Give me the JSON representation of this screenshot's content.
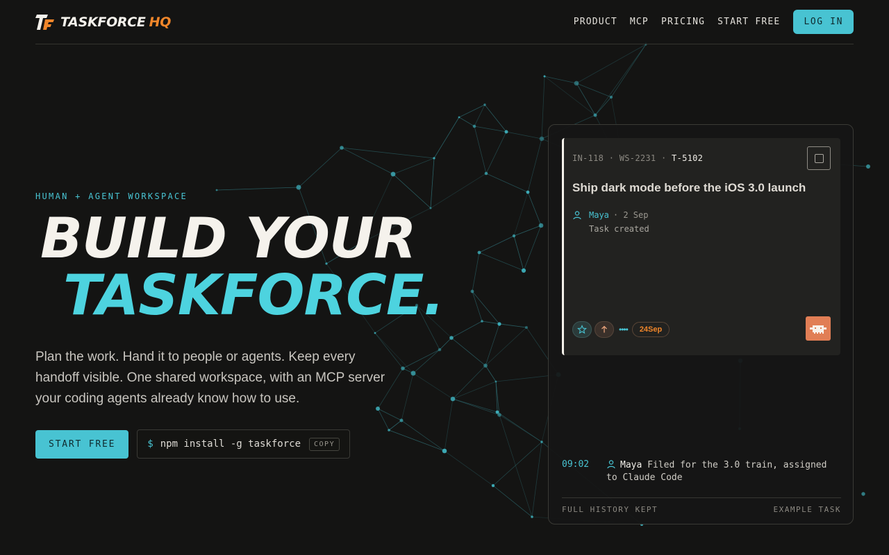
{
  "brand": {
    "name": "TASKFORCE",
    "suffix": "HQ"
  },
  "nav": {
    "items": [
      {
        "label": "PRODUCT"
      },
      {
        "label": "MCP"
      },
      {
        "label": "PRICING"
      },
      {
        "label": "START FREE"
      }
    ],
    "login_label": "LOG IN"
  },
  "hero": {
    "eyebrow": "HUMAN + AGENT WORKSPACE",
    "headline_line1": "BUILD YOUR",
    "headline_line2": "TASKFORCE.",
    "subhead": "Plan the work. Hand it to people or agents. Keep every handoff visible. One shared workspace, with an MCP server your coding agents already know how to use.",
    "cta_label": "START FREE",
    "install_prompt": "$",
    "install_command": "npm install -g taskforce",
    "copy_label": "COPY"
  },
  "task_card": {
    "ids": [
      "IN-118",
      "WS-2231"
    ],
    "current_id": "T-5102",
    "separator": "·",
    "title": "Ship dark mode before the iOS 3.0 launch",
    "activity": {
      "user": "Maya",
      "date": "· 2 Sep",
      "note": "Task created"
    },
    "due": "24Sep",
    "icons": [
      "star-icon",
      "arrow-up-icon",
      "agent-avatar-icon"
    ]
  },
  "log": {
    "time": "09:02",
    "user": "Maya",
    "text": "Filed for the 3.0 train, assigned to Claude Code"
  },
  "panel_footer": {
    "left": "FULL HISTORY KEPT",
    "right": "EXAMPLE TASK"
  },
  "colors": {
    "background": "#141413",
    "accent": "#48c3d2",
    "accent_bright": "#4dd3df",
    "orange": "#f0862a",
    "avatar": "#e17e55",
    "text": "#f5f2ec"
  }
}
